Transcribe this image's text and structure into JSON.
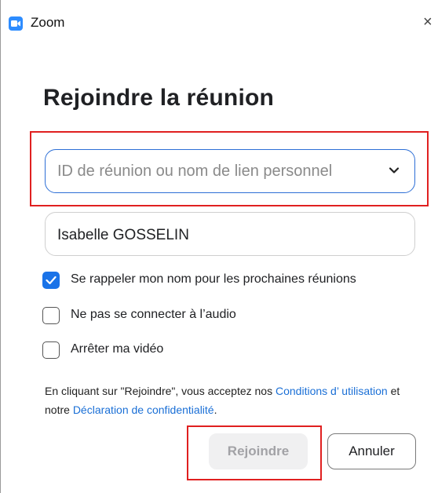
{
  "window": {
    "app_name": "Zoom",
    "close_glyph": "×"
  },
  "dialog": {
    "heading": "Rejoindre la réunion",
    "meeting_id_placeholder": "ID de réunion ou nom de lien personnel",
    "name_value": "Isabelle GOSSELIN",
    "options": [
      {
        "label": "Se rappeler mon nom pour les prochaines réunions",
        "checked": true
      },
      {
        "label": "Ne pas se connecter à l’audio",
        "checked": false
      },
      {
        "label": "Arrêter ma vidéo",
        "checked": false
      }
    ],
    "legal": {
      "prefix": "En cliquant sur \"Rejoindre\", vous acceptez nos ",
      "terms_link": "Conditions d’ utilisation",
      "middle": " et notre ",
      "privacy_link": "Déclaration de confidentialité",
      "suffix": "."
    },
    "buttons": {
      "join": "Rejoindre",
      "cancel": "Annuler"
    }
  },
  "colors": {
    "accent": "#2d8cff",
    "link": "#1a6fd6",
    "highlight_box": "#e02020",
    "checkbox_checked": "#1a73e8",
    "disabled_text": "#a2a2a6"
  },
  "icons": {
    "app": "zoom-camera-icon",
    "dropdown": "chevron-down-icon",
    "check": "checkmark-icon"
  }
}
